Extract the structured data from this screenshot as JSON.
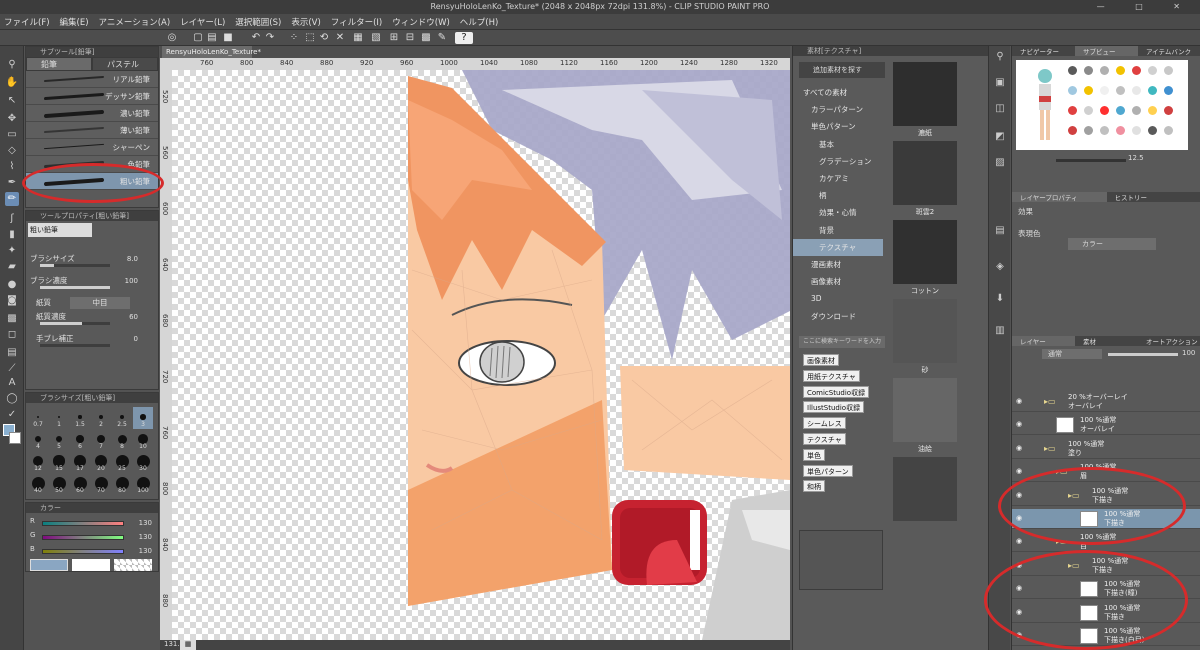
{
  "window": {
    "title": "RensyuHoloLenKo_Texture* (2048 x 2048px 72dpi 131.8%) - CLIP STUDIO PAINT PRO",
    "controls": [
      "—",
      "□",
      "✕"
    ]
  },
  "menu": [
    "ファイル(F)",
    "編集(E)",
    "アニメーション(A)",
    "レイヤー(L)",
    "選択範囲(S)",
    "表示(V)",
    "フィルター(I)",
    "ウィンドウ(W)",
    "ヘルプ(H)"
  ],
  "subtool": {
    "header": "サブツール[鉛筆]",
    "tabs": [
      "鉛筆",
      "パステル"
    ],
    "brushes": [
      "リアル鉛筆",
      "デッサン鉛筆",
      "濃い鉛筆",
      "薄い鉛筆",
      "シャーペン",
      "色鉛筆",
      "粗い鉛筆"
    ],
    "selected": "粗い鉛筆"
  },
  "tool_property": {
    "header": "ツールプロパティ[粗い鉛筆]",
    "name": "粗い鉛筆",
    "brush_size_label": "ブラシサイズ",
    "brush_size_value": "8.0",
    "brush_density_label": "ブラシ濃度",
    "brush_density_value": "100",
    "paper_label": "紙質",
    "paper_value": "中目",
    "paper_density_label": "紙質濃度",
    "paper_density_value": "60",
    "stabilize_label": "手ブレ補正",
    "stabilize_value": "0"
  },
  "brush_size": {
    "header": "ブラシサイズ[粗い鉛筆]",
    "sizes": [
      "0.7",
      "1",
      "1.5",
      "2",
      "2.5",
      "3",
      "4",
      "5",
      "6",
      "7",
      "8",
      "10",
      "12",
      "15",
      "17",
      "20",
      "25",
      "30",
      "40",
      "50",
      "60",
      "70",
      "80",
      "100"
    ],
    "selected": "3"
  },
  "color": {
    "header": "カラー",
    "r": "130",
    "g": "130",
    "b": "130",
    "fg": "#8ab0d0"
  },
  "canvas": {
    "tab": "RensyuHoloLenKo_Texture*",
    "ruler_top": [
      "760",
      "800",
      "840",
      "880",
      "920",
      "960",
      "1000",
      "1040",
      "1080",
      "1120",
      "1160",
      "1200",
      "1240",
      "1280",
      "1320"
    ],
    "ruler_left": [
      "520",
      "560",
      "600",
      "640",
      "680",
      "720",
      "760",
      "800",
      "840",
      "880"
    ],
    "zoom": "131.8"
  },
  "material": {
    "header": "素材[テクスチャ]",
    "add_button": "追加素材を探す",
    "tree": [
      "すべての素材",
      "カラーパターン",
      "単色パターン",
      "基本",
      "グラデーション",
      "カケアミ",
      "柄",
      "効果・心情",
      "背景",
      "テクスチャ",
      "漫画素材",
      "画像素材",
      "3D",
      "ダウンロード"
    ],
    "selected_tree": "テクスチャ",
    "search_placeholder": "ここに検索キーワードを入力",
    "tags": [
      "画像素材",
      "用紙テクスチャ",
      "ComicStudio収録",
      "IllustStudio収録",
      "シームレス",
      "テクスチャ",
      "単色",
      "単色パターン",
      "和柄"
    ],
    "thumbs": [
      "漉紙",
      "斑雲2",
      "コットン",
      "砂",
      "油絵",
      ""
    ]
  },
  "navigator": {
    "tabs": [
      "ナビゲーター",
      "サブビュー",
      "アイテムバンク"
    ],
    "zoom": "12.5",
    "palette_colors": [
      "#5a5a5a",
      "#8a8a8a",
      "#b0b0b0",
      "#f2c200",
      "#e04040",
      "#d0d0d0",
      "#c8c8c8",
      "#a0c8e0",
      "#f2c200",
      "#f0f0f0",
      "#c0c0c0",
      "#e8e8e8",
      "#40b8c0",
      "#4090d0",
      "#e04040",
      "#d0d0d0",
      "#ff3030",
      "#50a8d0",
      "#b0b0b0",
      "#ffd050",
      "#d04040",
      "#d04040",
      "#a0a0a0",
      "#c0c0c0",
      "#f090a0",
      "#e0e0e0",
      "#5a5a5a",
      "#c0c0c0"
    ]
  },
  "layer_property": {
    "tabs": [
      "レイヤープロパティ",
      "ヒストリー"
    ],
    "effect_label": "効果",
    "display_color_label": "表現色",
    "display_color_value": "カラー"
  },
  "layers": {
    "tabs": [
      "レイヤー",
      "素材",
      "オートアクション"
    ],
    "blend": "通常",
    "opacity": "100",
    "rows": [
      {
        "name": "20 %オーバーレイ\nオーバレイ",
        "kind": "folder",
        "indent": 1
      },
      {
        "name": "100 %通常\nオーバレイ",
        "kind": "layer",
        "indent": 2
      },
      {
        "name": "100 %通常\n塗り",
        "kind": "folder",
        "indent": 1
      },
      {
        "name": "100 %通常\n眉",
        "kind": "folder",
        "indent": 2
      },
      {
        "name": "100 %通常\n下描き",
        "kind": "folder",
        "indent": 3
      },
      {
        "name": "100 %通常\n下描き",
        "kind": "layer",
        "indent": 4,
        "selected": true
      },
      {
        "name": "100 %通常\n目",
        "kind": "folder",
        "indent": 2
      },
      {
        "name": "100 %通常\n下描き",
        "kind": "folder",
        "indent": 3
      },
      {
        "name": "100 %通常\n下描き(瞳)",
        "kind": "layer",
        "indent": 4
      },
      {
        "name": "100 %通常\n下描き",
        "kind": "layer",
        "indent": 4
      },
      {
        "name": "100 %通常\n下描き(白目)",
        "kind": "layer",
        "indent": 4
      }
    ]
  }
}
